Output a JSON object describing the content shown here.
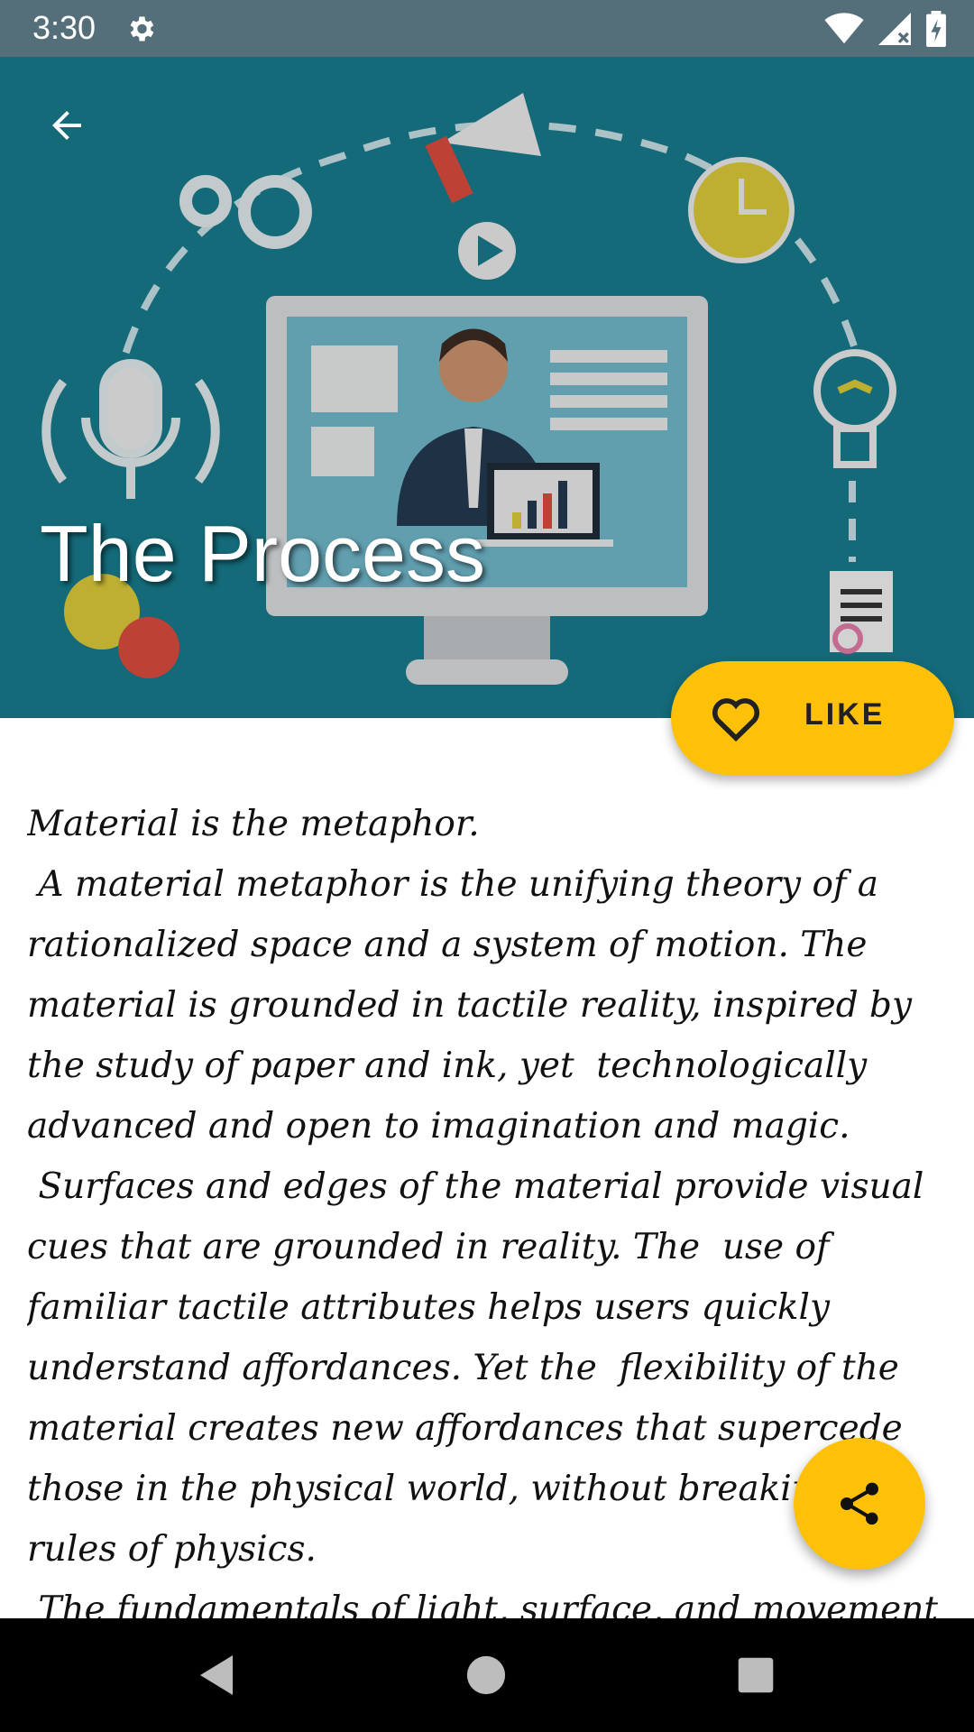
{
  "status_bar": {
    "time": "3:30",
    "icons": [
      "gear-icon",
      "wifi-icon",
      "signal-icon",
      "battery-icon"
    ]
  },
  "header": {
    "title": "The Process",
    "back_icon": "arrow-back-icon",
    "background_color": "#17798a"
  },
  "like_button": {
    "label": "LIKE",
    "icon": "heart-outline-icon",
    "color": "#ffc107"
  },
  "content": {
    "paragraphs": [
      "Material is the metaphor.",
      " A material metaphor is the unifying theory of a rationalized space and a system of motion. The material is grounded in tactile reality, inspired by the study of paper and ink, yet  technologically advanced and open to imagination and magic.",
      " Surfaces and edges of the material provide visual cues that are grounded in reality. The  use of familiar tactile attributes helps users quickly understand affordances. Yet the  flexibility of the material creates new affordances that supercede those in the physical world, without breaking the rules of physics.",
      " The fundamentals of light, surface, and movement are key to conveying how objects move,  interact, and"
    ]
  },
  "share_fab": {
    "icon": "share-icon",
    "color": "#ffc107"
  },
  "nav_bar": {
    "icons": [
      "back-triangle-icon",
      "home-circle-icon",
      "recents-square-icon"
    ]
  }
}
